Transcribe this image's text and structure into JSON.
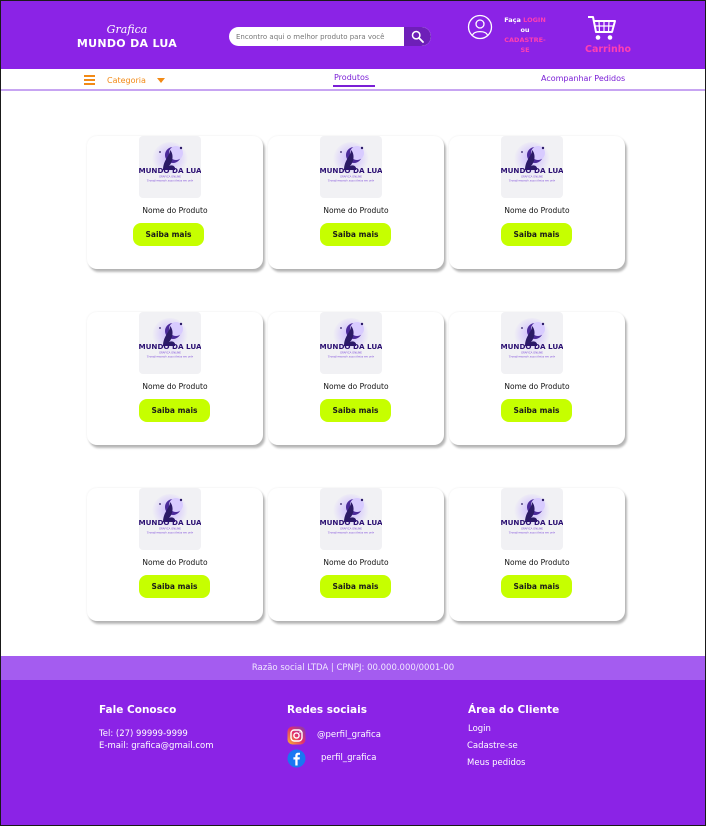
{
  "header": {
    "logo_script": "Grafica",
    "logo_name": "MUNDO DA LUA",
    "search_placeholder": "Encontro aqui o melhor produto para você",
    "login_line1_prefix": "Faça",
    "login_line1_link": "LOGIN",
    "login_line2": "ou",
    "login_line3": "CADASTRE-",
    "login_line4": "SE",
    "cart_label": "Carrinho"
  },
  "nav": {
    "category_label": "Categoria",
    "products_tab": "Produtos",
    "orders_tab": "Acompanhar Pedidos"
  },
  "thumbnail": {
    "title": "MUNDO DA LUA",
    "subtitle": "GRÁFICA ONLINE",
    "tagline": "Transformando suas ideias em arte"
  },
  "products": [
    {
      "name": "Nome do Produto",
      "button": "Saiba mais"
    },
    {
      "name": "Nome do Produto",
      "button": "Saiba mais"
    },
    {
      "name": "Nome do Produto",
      "button": "Saiba mais"
    },
    {
      "name": "Nome do Produto",
      "button": "Saiba mais"
    },
    {
      "name": "Nome do Produto",
      "button": "Saiba mais"
    },
    {
      "name": "Nome do Produto",
      "button": "Saiba mais"
    },
    {
      "name": "Nome do Produto",
      "button": "Saiba mais"
    },
    {
      "name": "Nome do Produto",
      "button": "Saiba mais"
    },
    {
      "name": "Nome do Produto",
      "button": "Saiba mais"
    }
  ],
  "footer": {
    "legal": "Razão social LTDA | CPNPJ: 00.000.000/0001-00",
    "contact_title": "Fale Conosco",
    "phone": "Tel: (27) 99999-9999",
    "email": "E-mail: grafica@gmail.com",
    "social_title": "Redes sociais",
    "instagram": "@perfil_grafica",
    "facebook": "perfil_grafica",
    "client_title": "Área do Cliente",
    "client_login": "Login",
    "client_register": "Cadastre-se",
    "client_orders": "Meus  pedidos"
  },
  "colors": {
    "brand_purple": "#8b23e6",
    "accent_pink": "#ff3fb2",
    "button_lime": "#c6ff00",
    "nav_orange": "#f28a16"
  }
}
